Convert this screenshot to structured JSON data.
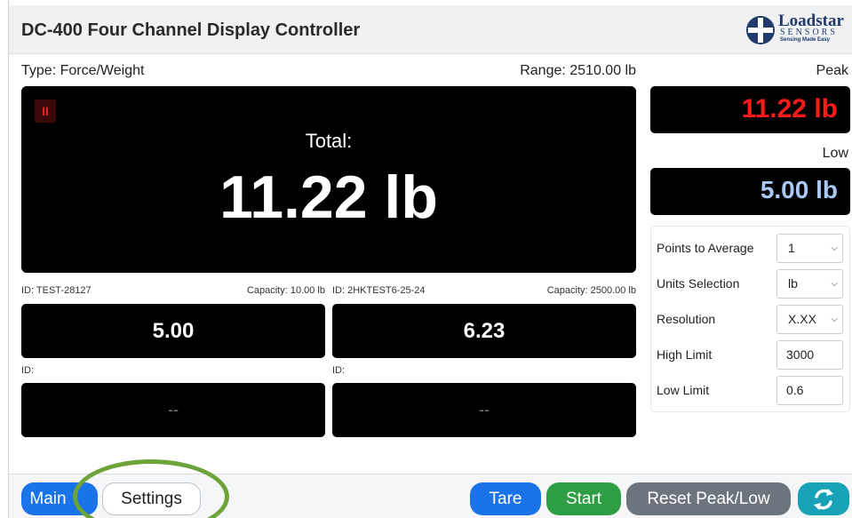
{
  "header": {
    "title": "DC-400 Four Channel Display Controller",
    "logo": {
      "name": "Loadstar",
      "sensors": "SENSORS",
      "tagline": "Sensing Made Easy"
    }
  },
  "main": {
    "type_label": "Type: Force/Weight",
    "range_label": "Range: 2510.00 lb",
    "pause_icon": "pause-icon",
    "pause_symbol": "II",
    "total_label": "Total:",
    "total_value": "11.22 lb"
  },
  "channels": [
    {
      "id": "ID: TEST-28127",
      "capacity": "Capacity: 10.00 lb",
      "value": "5.00"
    },
    {
      "id": "ID: 2HKTEST6-25-24",
      "capacity": "Capacity: 2500.00 lb",
      "value": "6.23"
    },
    {
      "id": "ID:",
      "capacity": "",
      "value": "--"
    },
    {
      "id": "ID:",
      "capacity": "",
      "value": "--"
    }
  ],
  "peak": {
    "label": "Peak",
    "value": "11.22 lb",
    "color": "#ff1a1a"
  },
  "low": {
    "label": "Low",
    "value": "5.00 lb",
    "color": "#a9c8f5"
  },
  "settings": {
    "points_to_average": {
      "label": "Points to Average",
      "value": "1"
    },
    "units_selection": {
      "label": "Units Selection",
      "value": "lb"
    },
    "resolution": {
      "label": "Resolution",
      "value": "X.XX"
    },
    "high_limit": {
      "label": "High Limit",
      "value": "3000"
    },
    "low_limit": {
      "label": "Low Limit",
      "value": "0.6"
    }
  },
  "footer": {
    "main_label": "Main",
    "settings_label": "Settings",
    "tare_label": "Tare",
    "start_label": "Start",
    "reset_label": "Reset Peak/Low",
    "refresh_icon": "refresh-icon"
  },
  "colors": {
    "primary": "#1a73e8",
    "success": "#2e9e44",
    "secondary": "#6c757d",
    "info": "#17a2b8",
    "highlight": "#6ea33a"
  }
}
